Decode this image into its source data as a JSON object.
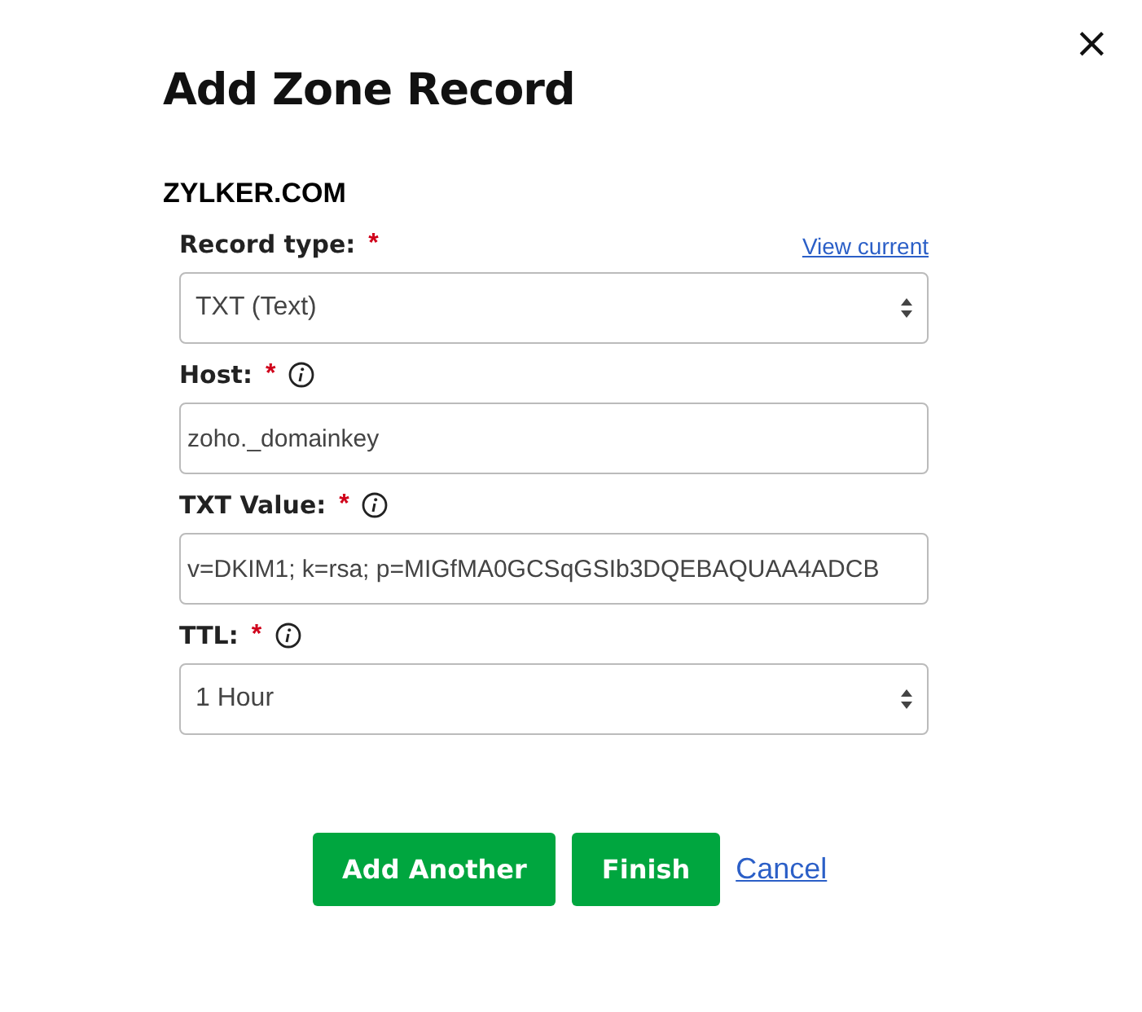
{
  "dialog": {
    "title": "Add Zone Record",
    "close": "×",
    "domain": "ZYLKER.COM",
    "fields": [
      {
        "kind": "select",
        "label": "Record type:",
        "required": "*",
        "info": false,
        "link": "View current",
        "value": "TXT (Text)"
      },
      {
        "kind": "text",
        "label": "Host:",
        "required": "*",
        "info": true,
        "value": "zoho._domainkey"
      },
      {
        "kind": "text",
        "label": "TXT Value:",
        "required": "*",
        "info": true,
        "value": "v=DKIM1; k=rsa; p=MIGfMA0GCSqGSIb3DQEBAQUAA4ADCB"
      },
      {
        "kind": "select",
        "label": "TTL:",
        "required": "*",
        "info": true,
        "value": "1 Hour"
      }
    ],
    "buttons": [
      {
        "kind": "primary",
        "label": "Add Another"
      },
      {
        "kind": "primary",
        "label": "Finish"
      },
      {
        "kind": "link",
        "label": "Cancel"
      }
    ]
  }
}
